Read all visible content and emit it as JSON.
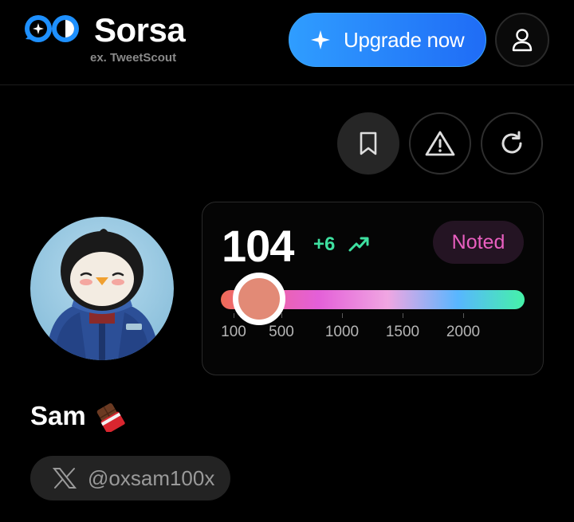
{
  "header": {
    "brand": "Sorsa",
    "brand_sub": "ex. TweetScout",
    "upgrade_label": "Upgrade now"
  },
  "actions": {
    "bookmark_icon": "bookmark-icon",
    "warning_icon": "warning-triangle-icon",
    "refresh_icon": "refresh-icon"
  },
  "profile": {
    "name": "Sam",
    "name_emoji": "🍫",
    "handle": "@oxsam100x",
    "avatar": "penguin-avatar"
  },
  "score": {
    "value": "104",
    "delta": "+6",
    "badge": "Noted",
    "slider_value": 104,
    "scale_labels": [
      "100",
      "500",
      "1000",
      "1500",
      "2000"
    ]
  },
  "colors": {
    "accent_blue": "#1f6cf6",
    "delta_green": "#3ee0a0",
    "badge_pink": "#e95fc0",
    "knob": "#e28a76"
  }
}
